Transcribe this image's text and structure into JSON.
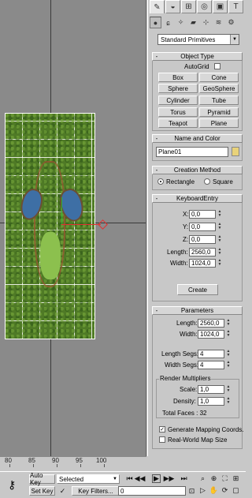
{
  "command_panel": {
    "tabs": [
      "create",
      "modify",
      "hierarchy",
      "motion",
      "display",
      "utilities"
    ],
    "subtabs": [
      "geometry",
      "shapes",
      "lights",
      "cameras",
      "helpers",
      "space-warps",
      "systems"
    ],
    "category": "Standard Primitives",
    "object_type": {
      "title": "Object Type",
      "autogrid_label": "AutoGrid",
      "buttons": [
        "Box",
        "Cone",
        "Sphere",
        "GeoSphere",
        "Cylinder",
        "Tube",
        "Torus",
        "Pyramid",
        "Teapot",
        "Plane"
      ]
    },
    "name_color": {
      "title": "Name and Color",
      "name": "Plane01",
      "color": "#e8d27a"
    },
    "creation_method": {
      "title": "Creation Method",
      "options": [
        "Rectangle",
        "Square"
      ],
      "selected": "Rectangle"
    },
    "keyboard_entry": {
      "title": "KeyboardEntry",
      "x_label": "X:",
      "x": "0,0",
      "y_label": "Y:",
      "y": "0,0",
      "z_label": "Z:",
      "z": "0,0",
      "length_label": "Length:",
      "length": "2560,0",
      "width_label": "Width:",
      "width": "1024,0",
      "create_label": "Create"
    },
    "parameters": {
      "title": "Parameters",
      "length_label": "Length:",
      "length": "2560,0",
      "width_label": "Width:",
      "width": "1024,0",
      "length_segs_label": "Length Segs:",
      "length_segs": "4",
      "width_segs_label": "Width Segs:",
      "width_segs": "4",
      "render_multipliers_label": "Render Multipliers",
      "scale_label": "Scale:",
      "scale": "1,0",
      "density_label": "Density:",
      "density": "1,0",
      "total_faces": "Total Faces : 32",
      "generate_mapping": "Generate Mapping Coords.",
      "real_world": "Real-World Map Size"
    }
  },
  "timeline": {
    "ticks": [
      "80",
      "85",
      "90",
      "95",
      "100"
    ]
  },
  "bottom_bar": {
    "auto_key": "Auto Key",
    "selected": "Selected",
    "set_key": "Set Key",
    "key_filters": "Key Filters...",
    "frame": "0"
  }
}
